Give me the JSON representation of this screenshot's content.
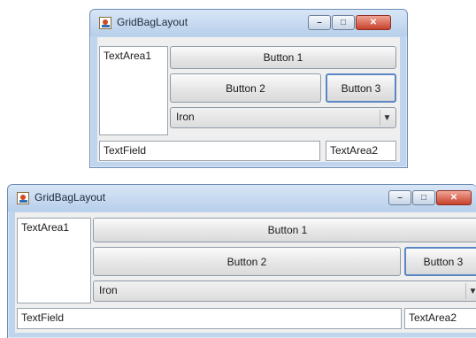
{
  "windows": [
    {
      "title": "GridBagLayout",
      "textarea1": "TextArea1",
      "button1": "Button 1",
      "button2": "Button 2",
      "button3": "Button 3",
      "combo_value": "Iron",
      "textfield": "TextField",
      "textarea2": "TextArea2",
      "controls": {
        "minimize": "–",
        "maximize": "□",
        "close": "✕"
      },
      "icon": "java-cup-icon"
    },
    {
      "title": "GridBagLayout",
      "textarea1": "TextArea1",
      "button1": "Button 1",
      "button2": "Button 2",
      "button3": "Button 3",
      "combo_value": "Iron",
      "textfield": "TextField",
      "textarea2": "TextArea2",
      "controls": {
        "minimize": "–",
        "maximize": "□",
        "close": "✕"
      },
      "icon": "java-cup-icon"
    }
  ],
  "colors": {
    "title_bar": "#bfd5ee",
    "close_button": "#c7402a",
    "focus_border": "#5a86c4"
  }
}
